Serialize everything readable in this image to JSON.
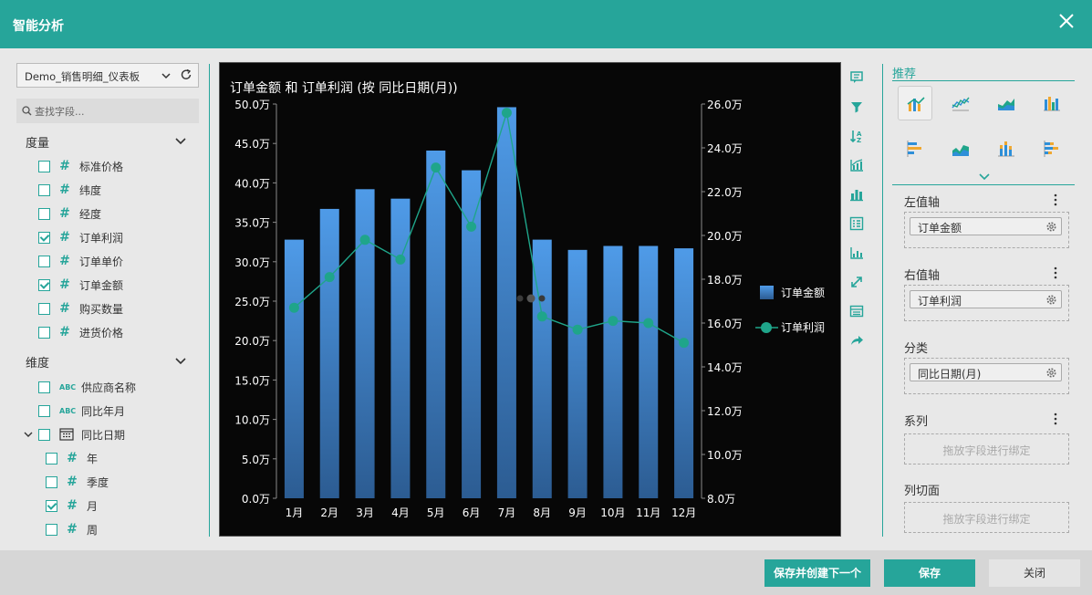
{
  "window": {
    "title": "智能分析"
  },
  "datasource": {
    "selected": "Demo_销售明细_仪表板"
  },
  "search": {
    "placeholder": "查找字段..."
  },
  "measures": {
    "title": "度量",
    "items": [
      {
        "label": "标准价格",
        "checked": false
      },
      {
        "label": "纬度",
        "checked": false
      },
      {
        "label": "经度",
        "checked": false
      },
      {
        "label": "订单利润",
        "checked": true
      },
      {
        "label": "订单单价",
        "checked": false
      },
      {
        "label": "订单金额",
        "checked": true
      },
      {
        "label": "购买数量",
        "checked": false
      },
      {
        "label": "进货价格",
        "checked": false
      }
    ]
  },
  "dimensions": {
    "title": "维度",
    "items": [
      {
        "label": "供应商名称",
        "type": "ABC"
      },
      {
        "label": "同比年月",
        "type": "ABC"
      },
      {
        "label": "同比日期",
        "type": "date"
      }
    ],
    "date_children": [
      {
        "label": "年",
        "checked": false
      },
      {
        "label": "季度",
        "checked": false
      },
      {
        "label": "月",
        "checked": true
      },
      {
        "label": "周",
        "checked": false
      }
    ]
  },
  "chart_data": {
    "type": "bar",
    "title": "订单金额 和 订单利润 (按 同比日期(月))",
    "categories": [
      "1月",
      "2月",
      "3月",
      "4月",
      "5月",
      "6月",
      "7月",
      "8月",
      "9月",
      "10月",
      "11月",
      "12月"
    ],
    "series": [
      {
        "name": "订单金额",
        "type": "bar",
        "axis": "left",
        "color": "#4a90e2",
        "values": [
          32.8,
          36.7,
          39.2,
          38.0,
          44.1,
          41.6,
          49.6,
          32.8,
          31.5,
          32.0,
          32.0,
          31.7
        ]
      },
      {
        "name": "订单利润",
        "type": "line",
        "axis": "right",
        "color": "#1fa58a",
        "values": [
          16.7,
          18.1,
          19.8,
          18.9,
          23.1,
          20.4,
          25.6,
          16.3,
          15.7,
          16.1,
          16.0,
          15.1
        ]
      }
    ],
    "yleft": {
      "min": 0,
      "max": 50,
      "ticks": [
        "0.0万",
        "5.0万",
        "10.0万",
        "15.0万",
        "20.0万",
        "25.0万",
        "30.0万",
        "35.0万",
        "40.0万",
        "45.0万",
        "50.0万"
      ]
    },
    "yright": {
      "min": 8,
      "max": 26,
      "ticks": [
        "8.0万",
        "10.0万",
        "12.0万",
        "14.0万",
        "16.0万",
        "18.0万",
        "20.0万",
        "22.0万",
        "24.0万",
        "26.0万"
      ]
    },
    "legend": "right",
    "grid": false
  },
  "right": {
    "recommend_label": "推荐",
    "left_axis": {
      "title": "左值轴",
      "field": "订单金额"
    },
    "right_axis": {
      "title": "右值轴",
      "field": "订单利润"
    },
    "category": {
      "title": "分类",
      "field": "同比日期(月)"
    },
    "series": {
      "title": "系列",
      "placeholder": "拖放字段进行绑定"
    },
    "column_slice": {
      "title": "列切面",
      "placeholder": "拖放字段进行绑定"
    }
  },
  "footer": {
    "save_next": "保存并创建下一个",
    "save": "保存",
    "close": "关闭"
  },
  "colors": {
    "accent": "#26a59a",
    "bar": "#4a90e2",
    "line": "#1fa58a"
  }
}
